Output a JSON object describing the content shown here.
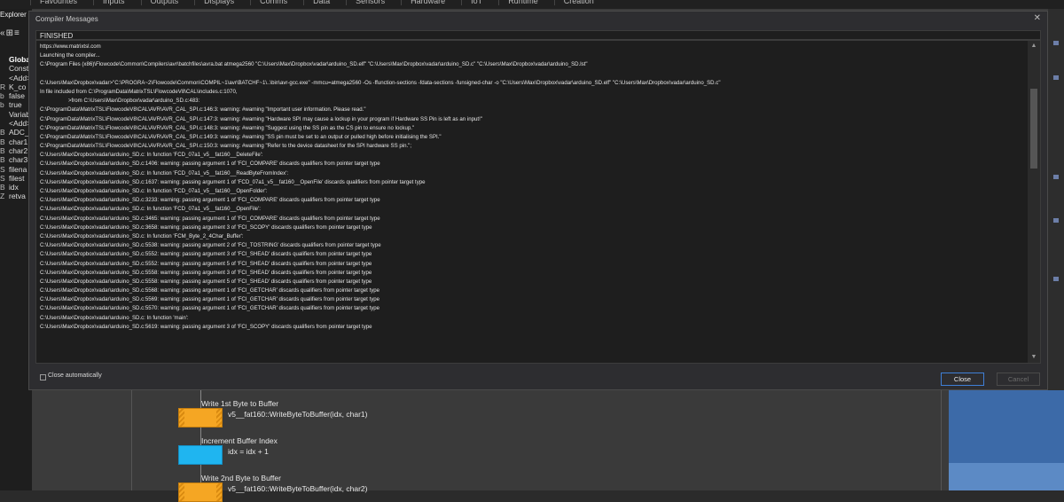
{
  "menubar": {
    "items": [
      "Favourites",
      "Inputs",
      "Outputs",
      "Displays",
      "Comms",
      "Data",
      "Sensors",
      "Hardware",
      "IoT",
      "Runtime",
      "Creation"
    ]
  },
  "explorer": {
    "title": "Explorer",
    "items": [
      {
        "icon": "",
        "label": "Globals",
        "sec": true
      },
      {
        "icon": "",
        "label": "Constants"
      },
      {
        "icon": "",
        "label": "<Add>"
      },
      {
        "icon": "R",
        "label": "K_co"
      },
      {
        "icon": "b",
        "label": "false"
      },
      {
        "icon": "b",
        "label": "true"
      },
      {
        "icon": "",
        "label": "Variables"
      },
      {
        "icon": "",
        "label": "<Add>"
      },
      {
        "icon": "B",
        "label": "ADC_"
      },
      {
        "icon": "B",
        "label": "char1"
      },
      {
        "icon": "B",
        "label": "char2"
      },
      {
        "icon": "B",
        "label": "char3"
      },
      {
        "icon": "S",
        "label": "filena"
      },
      {
        "icon": "S",
        "label": "filest"
      },
      {
        "icon": "B",
        "label": "idx"
      },
      {
        "icon": "Z",
        "label": "retva"
      }
    ]
  },
  "dialog": {
    "title": "Compiler Messages",
    "status": "FINISHED",
    "log": [
      "https://www.matrixtsl.com",
      "Launching the compiler...",
      "C:\\Program Files (x86)\\Flowcode\\Common\\Compilers\\avr\\batchfiles\\avra.bat  atmega2560 \"C:\\Users\\Max\\Dropbox\\vadar\\arduino_SD.elf\" \"C:\\Users\\Max\\Dropbox\\vadar\\arduino_SD.c\" \"C:\\Users\\Max\\Dropbox\\vadar\\arduino_SD.lst\"",
      "",
      "C:\\Users\\Max\\Dropbox\\vadar>\"C:\\PROGRA~2\\Flowcode\\Common\\COMPIL~1\\avr\\BATCHF~1\\..\\bin\\avr-gcc.exe\" -mmcu=atmega2560 -Os -ffunction-sections -fdata-sections -funsigned-char -o \"C:\\Users\\Max\\Dropbox\\vadar\\arduino_SD.elf\" \"C:\\Users\\Max\\Dropbox\\vadar\\arduino_SD.c\"",
      "In file included from C:\\ProgramData\\MatrixTSL\\FlowcodeV8\\CAL\\includes.c:1070,",
      ">from C:\\Users\\Max\\Dropbox\\vadar\\arduino_SD.c:483:",
      "C:\\ProgramData\\MatrixTSL\\FlowcodeV8\\CAL\\AVR\\AVR_CAL_SPI.c:146:3: warning: #warning \"Important user information. Please read.\"",
      "C:\\ProgramData\\MatrixTSL\\FlowcodeV8\\CAL\\AVR\\AVR_CAL_SPI.c:147:3: warning: #warning \"Hardware SPI may cause a lockup in your program if Hardware SS Pin is left as an input!\"",
      "C:\\ProgramData\\MatrixTSL\\FlowcodeV8\\CAL\\AVR\\AVR_CAL_SPI.c:148:3: warning: #warning \"Suggest using the SS pin as the CS pin to ensure no lockup.\"",
      "C:\\ProgramData\\MatrixTSL\\FlowcodeV8\\CAL\\AVR\\AVR_CAL_SPI.c:149:3: warning: #warning \"SS pin must be set to an output or pulled high before initialising the SPI.\"",
      "C:\\ProgramData\\MatrixTSL\\FlowcodeV8\\CAL\\AVR\\AVR_CAL_SPI.c:150:3: warning: #warning \"Refer to the device datasheet for the SPI hardware SS pin.\";",
      "C:\\Users\\Max\\Dropbox\\vadar\\arduino_SD.c: In function 'FCD_07a1_v5__fat160__DeleteFile':",
      "C:\\Users\\Max\\Dropbox\\vadar\\arduino_SD.c:1406: warning: passing argument 1 of 'FCI_COMPARE' discards qualifiers from pointer target type",
      "C:\\Users\\Max\\Dropbox\\vadar\\arduino_SD.c: In function 'FCD_07a1_v5__fat160__ReadByteFromIndex':",
      "C:\\Users\\Max\\Dropbox\\vadar\\arduino_SD.c:1637: warning: passing argument 1 of 'FCD_07a1_v5__fat160__OpenFile' discards qualifiers from pointer target type",
      "C:\\Users\\Max\\Dropbox\\vadar\\arduino_SD.c: In function 'FCD_07a1_v5__fat160__OpenFolder':",
      "C:\\Users\\Max\\Dropbox\\vadar\\arduino_SD.c:3233: warning: passing argument 1 of 'FCI_COMPARE' discards qualifiers from pointer target type",
      "C:\\Users\\Max\\Dropbox\\vadar\\arduino_SD.c: In function 'FCD_07a1_v5__fat160__OpenFile':",
      "C:\\Users\\Max\\Dropbox\\vadar\\arduino_SD.c:3465: warning: passing argument 1 of 'FCI_COMPARE' discards qualifiers from pointer target type",
      "C:\\Users\\Max\\Dropbox\\vadar\\arduino_SD.c:3658: warning: passing argument 3 of 'FCI_SCOPY' discards qualifiers from pointer target type",
      "C:\\Users\\Max\\Dropbox\\vadar\\arduino_SD.c: In function 'FCM_Byte_2_4Char_Buffer':",
      "C:\\Users\\Max\\Dropbox\\vadar\\arduino_SD.c:5538: warning: passing argument 2 of 'FCI_TOSTRING' discards qualifiers from pointer target type",
      "C:\\Users\\Max\\Dropbox\\vadar\\arduino_SD.c:5552: warning: passing argument 3 of 'FCI_SHEAD' discards qualifiers from pointer target type",
      "C:\\Users\\Max\\Dropbox\\vadar\\arduino_SD.c:5552: warning: passing argument 5 of 'FCI_SHEAD' discards qualifiers from pointer target type",
      "C:\\Users\\Max\\Dropbox\\vadar\\arduino_SD.c:5558: warning: passing argument 3 of 'FCI_SHEAD' discards qualifiers from pointer target type",
      "C:\\Users\\Max\\Dropbox\\vadar\\arduino_SD.c:5558: warning: passing argument 5 of 'FCI_SHEAD' discards qualifiers from pointer target type",
      "C:\\Users\\Max\\Dropbox\\vadar\\arduino_SD.c:5568: warning: passing argument 1 of 'FCI_GETCHAR' discards qualifiers from pointer target type",
      "C:\\Users\\Max\\Dropbox\\vadar\\arduino_SD.c:5569: warning: passing argument 1 of 'FCI_GETCHAR' discards qualifiers from pointer target type",
      "C:\\Users\\Max\\Dropbox\\vadar\\arduino_SD.c:5570: warning: passing argument 1 of 'FCI_GETCHAR' discards qualifiers from pointer target type",
      "C:\\Users\\Max\\Dropbox\\vadar\\arduino_SD.c: In function 'main':",
      "C:\\Users\\Max\\Dropbox\\vadar\\arduino_SD.c:5619: warning: passing argument 3 of 'FCI_SCOPY' discards qualifiers from pointer target type"
    ],
    "close_automatically_label": "Close automatically",
    "close_automatically_checked": false,
    "close_button": "Close",
    "cancel_button": "Cancel"
  },
  "flowchart": {
    "blocks": [
      {
        "kind": "output",
        "label": "Write 1st Byte to Buffer",
        "expr": "v5__fat160::WriteByteToBuffer(idx, char1)",
        "color": "#f5a623"
      },
      {
        "kind": "calc",
        "label": "Increment Buffer Index",
        "expr": "idx = idx + 1",
        "color": "#1fb5f0"
      },
      {
        "kind": "output",
        "label": "Write 2nd Byte to Buffer",
        "expr": "v5__fat160::WriteByteToBuffer(idx, char2)",
        "color": "#f5a623"
      }
    ]
  },
  "icons": {
    "dialog_close": "close-icon",
    "scroll_up": "chevron-up-icon",
    "scroll_down": "chevron-down-icon"
  }
}
